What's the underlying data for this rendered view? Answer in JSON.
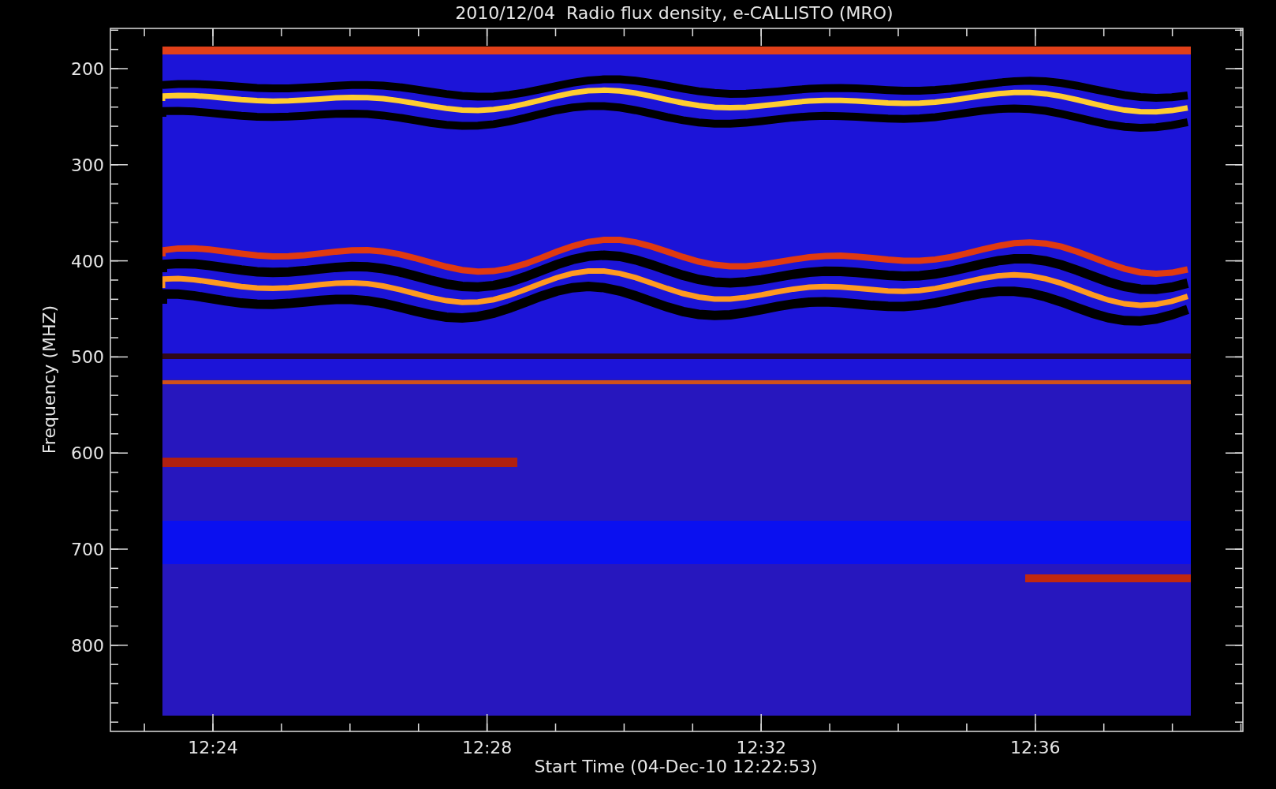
{
  "title": "2010/12/04  Radio flux density, e-CALLISTO (MRO)",
  "y_axis": {
    "label": "Frequency (MHZ)",
    "ticks": [
      "200",
      "300",
      "400",
      "500",
      "600",
      "700",
      "800"
    ]
  },
  "x_axis": {
    "label": "Start Time (04-Dec-10 12:22:53)",
    "ticks": [
      "12:24",
      "12:28",
      "12:32",
      "12:36"
    ]
  }
}
